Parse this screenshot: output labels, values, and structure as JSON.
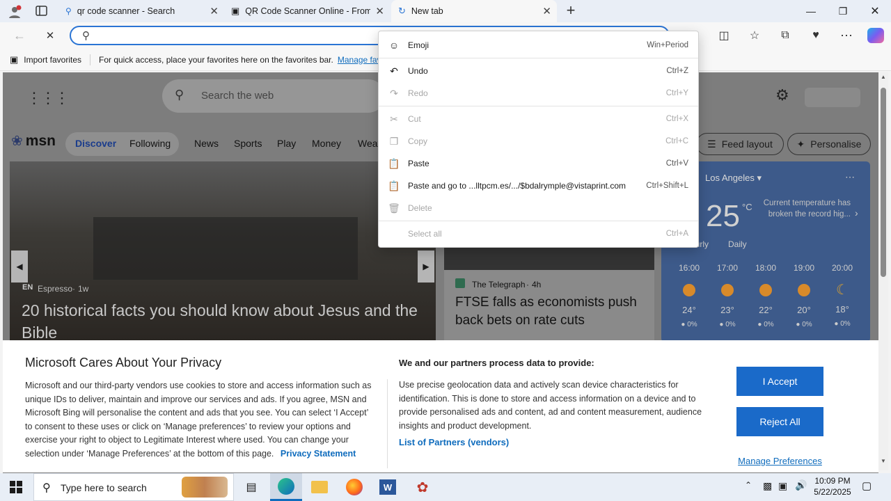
{
  "tabs": [
    {
      "title": "qr code scanner - Search"
    },
    {
      "title": "QR Code Scanner Online - From Im"
    },
    {
      "title": "New tab"
    }
  ],
  "address": {
    "value": "",
    "placeholder": ""
  },
  "favorites_bar": {
    "import_label": "Import favorites",
    "hint": "For quick access, place your favorites here on the favorites bar.",
    "manage_link": "Manage favorites now"
  },
  "msn": {
    "search_placeholder": "Search the web",
    "logo_text": "msn",
    "nav": [
      "Discover",
      "Following",
      "News",
      "Sports",
      "Play",
      "Money",
      "Weather"
    ],
    "feed_layout": "Feed layout",
    "personalise": "Personalise",
    "hero": {
      "source": "Espresso",
      "age": "1w",
      "title": "20 historical facts you should know about Jesus and the Bible"
    },
    "card2": {
      "source": "The Telegraph",
      "age": "4h",
      "title": "FTSE falls as economists push back bets on rate cuts"
    },
    "weather": {
      "location": "Los Angeles",
      "temp": "25",
      "unit": "°C",
      "note": "Current temperature has broken the record hig...",
      "tab_hourly": "Hourly",
      "tab_daily": "Daily",
      "hours": [
        {
          "time": "16:00",
          "temp": "24°",
          "rain": "0%"
        },
        {
          "time": "17:00",
          "temp": "23°",
          "rain": "0%"
        },
        {
          "time": "18:00",
          "temp": "22°",
          "rain": "0%"
        },
        {
          "time": "19:00",
          "temp": "20°",
          "rain": "0%"
        },
        {
          "time": "20:00",
          "temp": "18°",
          "rain": "0%"
        }
      ]
    }
  },
  "context_menu": {
    "items": [
      {
        "label": "Emoji",
        "shortcut": "Win+Period",
        "enabled": true,
        "icon": "emoji-icon"
      },
      {
        "label": "Undo",
        "shortcut": "Ctrl+Z",
        "enabled": true,
        "icon": "undo-icon"
      },
      {
        "label": "Redo",
        "shortcut": "Ctrl+Y",
        "enabled": false,
        "icon": "redo-icon"
      },
      {
        "label": "Cut",
        "shortcut": "Ctrl+X",
        "enabled": false,
        "icon": "cut-icon"
      },
      {
        "label": "Copy",
        "shortcut": "Ctrl+C",
        "enabled": false,
        "icon": "copy-icon"
      },
      {
        "label": "Paste",
        "shortcut": "Ctrl+V",
        "enabled": true,
        "icon": "paste-icon"
      },
      {
        "label": "Paste and go to ...lltpcm.es/.../$bdalrymple@vistaprint.com",
        "shortcut": "Ctrl+Shift+L",
        "enabled": true,
        "icon": "paste-go-icon"
      },
      {
        "label": "Delete",
        "shortcut": "",
        "enabled": false,
        "icon": "delete-icon"
      },
      {
        "label": "Select all",
        "shortcut": "Ctrl+A",
        "enabled": false,
        "icon": ""
      }
    ]
  },
  "privacy": {
    "title": "Microsoft Cares About Your Privacy",
    "body": "Microsoft and our third-party vendors use cookies to store and access information such as unique IDs to deliver, maintain and improve our services and ads. If you agree, MSN and Microsoft Bing will personalise the content and ads that you see. You can select ‘I Accept’ to consent to these uses or click on ‘Manage preferences’ to review your options and exercise your right to object to Legitimate Interest where used.  You can change your selection under ‘Manage Preferences’ at the bottom of this page.",
    "privacy_link": "Privacy Statement",
    "partners_title": "We and our partners process data to provide:",
    "partners_body": "Use precise geolocation data and actively scan device characteristics for identification. This is done to store and access information on a device and to provide personalised ads and content, ad and content measurement, audience insights and product development.",
    "partners_link": "List of Partners (vendors)",
    "accept": "I Accept",
    "reject": "Reject All",
    "manage": "Manage Preferences"
  },
  "taskbar": {
    "search_placeholder": "Type here to search",
    "time": "10:09 PM",
    "date": "5/22/2025"
  },
  "colors": {
    "accent": "#0f6cbd",
    "button_blue": "#1a6ac9",
    "taskbar": "#e8eef6"
  }
}
